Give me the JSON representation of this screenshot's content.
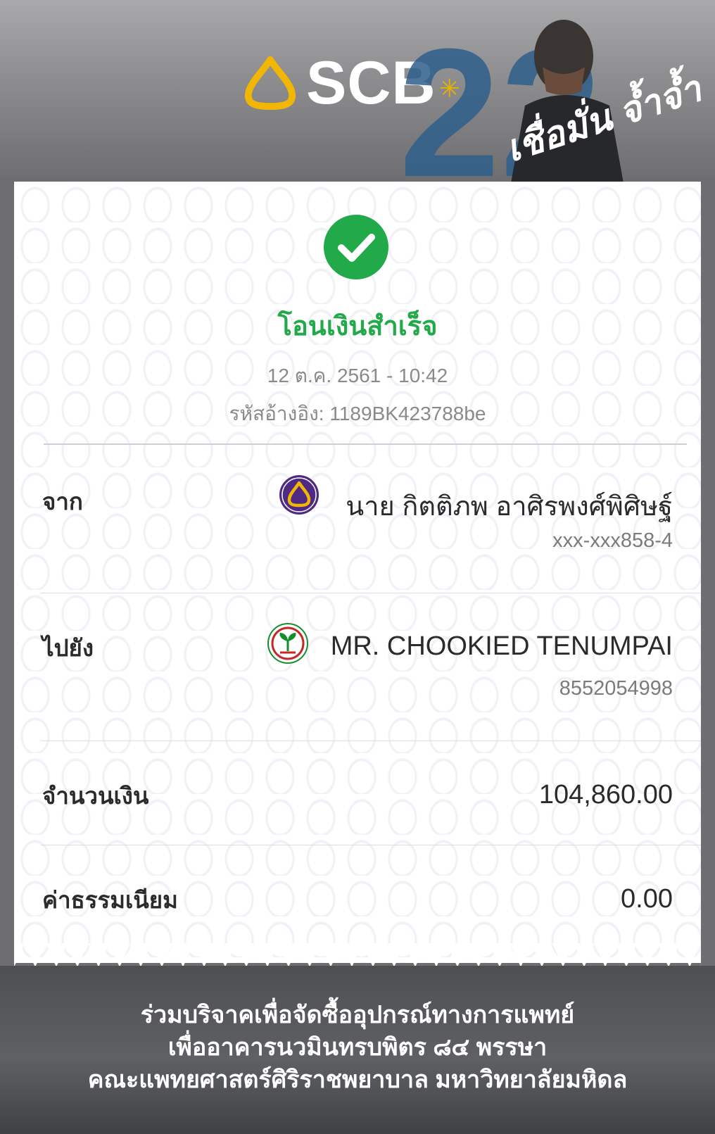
{
  "header": {
    "brand": "SCB",
    "promo_number": "22",
    "promo_text": "เชื่อมั่น จ้ำจ้ำ"
  },
  "receipt": {
    "status": "โอนเงินสำเร็จ",
    "datetime": "12 ต.ค. 2561 - 10:42",
    "reference_label": "รหัสอ้างอิง:",
    "reference_value": "1189BK423788be",
    "from": {
      "label": "จาก",
      "name": "นาย กิตติภพ อาศิรพงศ์พิศิษฐ์",
      "account": "xxx-xxx858-4",
      "bank_icon": "scb-bank-icon"
    },
    "to": {
      "label": "ไปยัง",
      "name": "MR. CHOOKIED TENUMPAI",
      "account": "8552054998",
      "bank_icon": "kbank-bank-icon"
    },
    "amount": {
      "label": "จำนวนเงิน",
      "value": "104,860.00"
    },
    "fee": {
      "label": "ค่าธรรมเนียม",
      "value": "0.00"
    }
  },
  "footer": {
    "line1": "ร่วมบริจาคเพื่อจัดซื้ออุปกรณ์ทางการแพทย์",
    "line2": "เพื่ออาคารนวมินทรบพิตร ๘๔ พรรษา",
    "line3": "คณะแพทยศาสตร์ศิริราชพยาบาล มหาวิทยาลัยมหิดล"
  },
  "colors": {
    "success_green": "#22a94a",
    "scb_purple": "#4e2a84",
    "scb_gold": "#f2b705",
    "kbank_green": "#138f2d"
  }
}
